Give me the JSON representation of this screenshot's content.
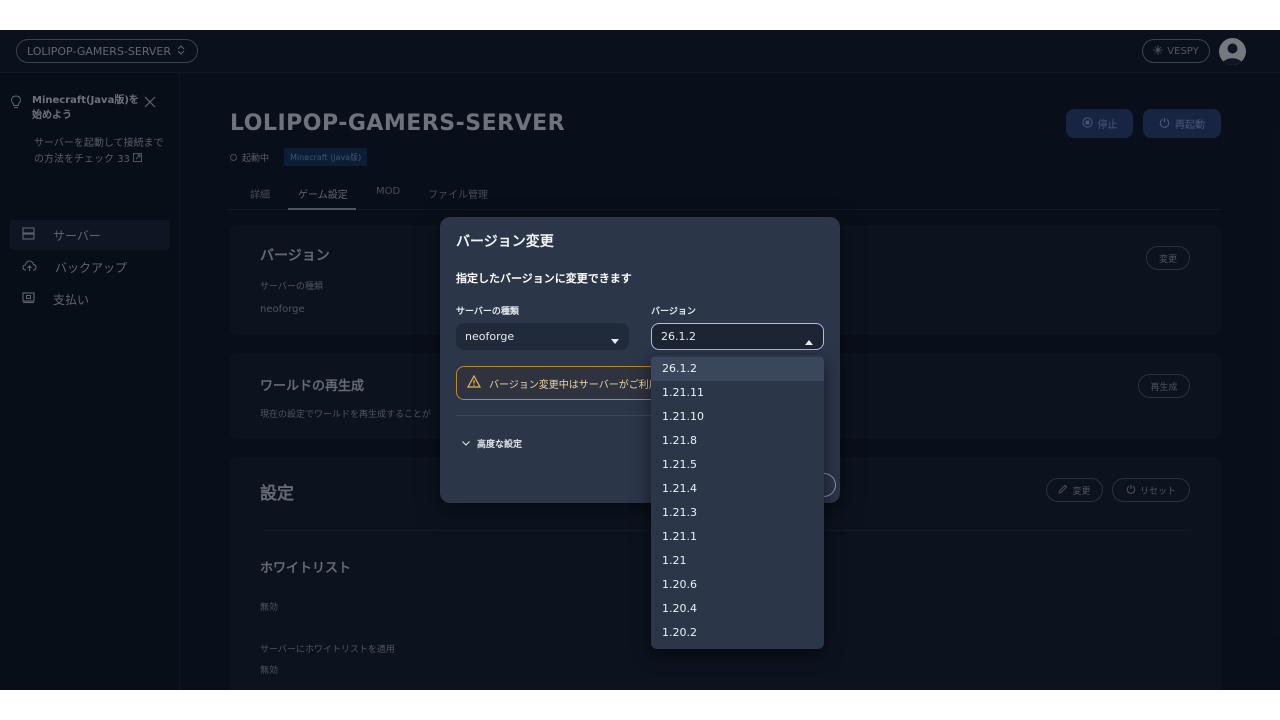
{
  "header": {
    "server_select": "LOLIPOP-GAMERS-SERVER",
    "user_name": "VESPY"
  },
  "sidebar": {
    "tip_title": "Minecraft(Java版)を始めよう",
    "tip_body": "サーバーを起動して接続までの方法をチェック",
    "tip_badge": "33",
    "items": [
      {
        "label": "サーバー",
        "icon": "server-icon"
      },
      {
        "label": "バックアップ",
        "icon": "cloud-upload-icon"
      },
      {
        "label": "支払い",
        "icon": "payment-icon"
      }
    ]
  },
  "server": {
    "title": "LOLIPOP-GAMERS-SERVER",
    "status": "起動中",
    "edition": "Minecraft (Java版)",
    "stop_label": "停止",
    "restart_label": "再起動"
  },
  "tabs": [
    {
      "label": "詳細"
    },
    {
      "label": "ゲーム設定"
    },
    {
      "label": "MOD"
    },
    {
      "label": "ファイル管理"
    }
  ],
  "version_card": {
    "title": "バージョン",
    "label": "サーバーの種類",
    "value": "neoforge",
    "button": "変更"
  },
  "world_card": {
    "title": "ワールドの再生成",
    "description": "現在の設定でワールドを再生成することが",
    "button": "再生成"
  },
  "settings_card": {
    "title": "設定",
    "edit_button": "変更",
    "reset_button": "リセット",
    "whitelist_title": "ホワイトリスト",
    "whitelist_value": "無効",
    "apply_label": "サーバーにホワイトリストを適用",
    "apply_value": "無効"
  },
  "modal": {
    "title": "バージョン変更",
    "subtitle": "指定したバージョンに変更できます",
    "server_type_label": "サーバーの種類",
    "server_type_value": "neoforge",
    "version_label": "バージョン",
    "version_value": "26.1.2",
    "warning": "バージョン変更中はサーバーがご利用",
    "advanced": "高度な設定"
  },
  "version_options": [
    "26.1.2",
    "1.21.11",
    "1.21.10",
    "1.21.8",
    "1.21.5",
    "1.21.4",
    "1.21.3",
    "1.21.1",
    "1.21",
    "1.20.6",
    "1.20.4",
    "1.20.2"
  ],
  "colors": {
    "background": "#0f1726",
    "modal": "#2b3649",
    "accent_focus": "#b1b6ff",
    "warning": "#e8b54a",
    "badge": "#15325a"
  }
}
